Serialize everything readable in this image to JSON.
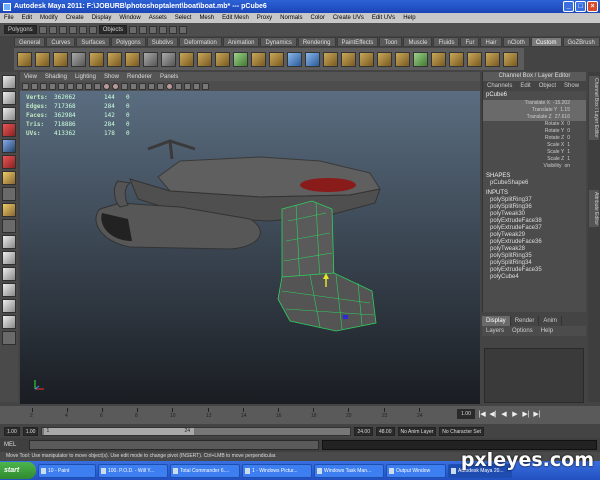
{
  "window": {
    "title": "Autodesk Maya 2011: F:\\JOBURB\\photoshoptalent\\boat\\boat.mb* --- pCube6",
    "minimize": "_",
    "maximize": "□",
    "close": "×"
  },
  "menubar": [
    "File",
    "Edit",
    "Modify",
    "Create",
    "Display",
    "Window",
    "Assets",
    "Select",
    "Mesh",
    "Edit Mesh",
    "Proxy",
    "Normals",
    "Color",
    "Create UVs",
    "Edit UVs",
    "Help"
  ],
  "statusline": {
    "mode": "Polygons",
    "selection_mode": "Objects"
  },
  "shelf": {
    "tabs": [
      "General",
      "Curves",
      "Surfaces",
      "Polygons",
      "Subdivs",
      "Deformation",
      "Animation",
      "Dynamics",
      "Rendering",
      "PaintEffects",
      "Toon",
      "Muscle",
      "Fluids",
      "Fur",
      "Hair",
      "nCloth",
      "Custom",
      "GoZBrush"
    ],
    "active_tab": "Custom"
  },
  "panel": {
    "menu": [
      "View",
      "Shading",
      "Lighting",
      "Show",
      "Renderer",
      "Panels"
    ]
  },
  "hud": {
    "rows": [
      {
        "label": "Verts:",
        "v1": "362062",
        "v2": "144",
        "v3": "0"
      },
      {
        "label": "Edges:",
        "v1": "717368",
        "v2": "284",
        "v3": "0"
      },
      {
        "label": "Faces:",
        "v1": "362984",
        "v2": "142",
        "v3": "0"
      },
      {
        "label": "Tris:",
        "v1": "718886",
        "v2": "284",
        "v3": "0"
      },
      {
        "label": "UVs:",
        "v1": "413362",
        "v2": "178",
        "v3": "0"
      }
    ]
  },
  "channelbox": {
    "header": "Channel Box / Layer Editor",
    "menu": [
      "Channels",
      "Edit",
      "Object",
      "Show"
    ],
    "object": "pCube6",
    "attributes": [
      {
        "name": "Translate X",
        "value": "-15.202"
      },
      {
        "name": "Translate Y",
        "value": "1.15"
      },
      {
        "name": "Translate Z",
        "value": "27.616"
      },
      {
        "name": "Rotate X",
        "value": "0"
      },
      {
        "name": "Rotate Y",
        "value": "0"
      },
      {
        "name": "Rotate Z",
        "value": "0"
      },
      {
        "name": "Scale X",
        "value": "1"
      },
      {
        "name": "Scale Y",
        "value": "1"
      },
      {
        "name": "Scale Z",
        "value": "1"
      },
      {
        "name": "Visibility",
        "value": "on"
      }
    ],
    "shapes_label": "SHAPES",
    "shape": "pCubeShape6",
    "inputs_label": "INPUTS",
    "inputs": [
      "polySplitRing37",
      "polySplitRing36",
      "polyTweak30",
      "polyExtrudeFace38",
      "polyExtrudeFace37",
      "polyTweak29",
      "polyExtrudeFace36",
      "polyTweak28",
      "polySplitRing35",
      "polySplitRing34",
      "polyExtrudeFace35",
      "polyCube4"
    ]
  },
  "layers": {
    "tabs": [
      "Display",
      "Render",
      "Anim"
    ],
    "menu": [
      "Layers",
      "Options",
      "Help"
    ]
  },
  "sidetabs": [
    "Channel Box / Layer Editor",
    "Attribute Editor"
  ],
  "timeline": {
    "ticks": [
      "2",
      "4",
      "6",
      "8",
      "10",
      "12",
      "14",
      "16",
      "18",
      "20",
      "22",
      "24"
    ],
    "current_frame": "1.00",
    "buttons": [
      "|◀",
      "◀|",
      "◀",
      "▶",
      "▶|",
      "▶|"
    ]
  },
  "range": {
    "start": "1.00",
    "inner_start": "1.00",
    "bar_start": "1",
    "bar_end": "24",
    "inner_end": "24.00",
    "end": "48.00",
    "anim_layer": "No Anim Layer",
    "character_set": "No Character Set"
  },
  "command": {
    "label": "MEL"
  },
  "helpline": "Move Tool: Use manipulator to move object(s). Use edit mode to change pivot (INSERT). Ctrl+LMB to move perpendicular.",
  "taskbar": {
    "start": "start",
    "tasks": [
      "10 - Paint",
      "100. P.O.D. - Will Y...",
      "Total Commander 6....",
      "1 - Windows Pictur...",
      "Windows Task Man...",
      "Output Window",
      "Autodesk Maya 20..."
    ],
    "active_index": 6
  },
  "watermark": "pxleyes.com"
}
